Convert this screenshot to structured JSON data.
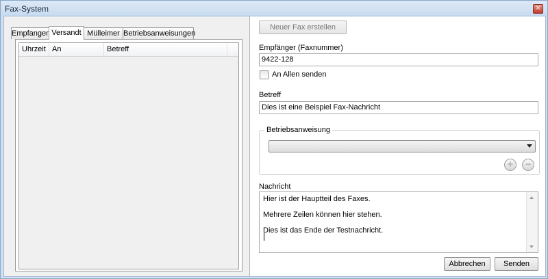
{
  "window": {
    "title": "Fax-System"
  },
  "tabs": [
    {
      "label": "Empfangen"
    },
    {
      "label": "Versandt",
      "active": true
    },
    {
      "label": "Mülleimer"
    },
    {
      "label": "Betriebsanweisungen"
    }
  ],
  "table": {
    "columns": [
      "Uhrzeit",
      "An",
      "Betreff"
    ],
    "rows": []
  },
  "form": {
    "new_fax_button": "Neuer Fax erstellen",
    "recipient_label": "Empfänger (Faxnummer)",
    "recipient_value": "9422-128",
    "send_all_label": "An Allen senden",
    "send_all_checked": false,
    "subject_label": "Betreff",
    "subject_value": "Dies ist eine Beispiel Fax-Nachricht",
    "instruction_group_label": "Betriebsanweisung",
    "instruction_selected": "",
    "message_label": "Nachricht",
    "message_lines": [
      "Hier ist der Hauptteil des Faxes.",
      "",
      "Mehrere Zeilen können hier stehen.",
      "",
      "Dies ist das Ende der Testnachricht."
    ],
    "cancel_button": "Abbrechen",
    "send_button": "Senden"
  },
  "icons": {
    "close": "close-icon",
    "add": "plus-circle-icon",
    "remove": "minus-circle-icon"
  }
}
